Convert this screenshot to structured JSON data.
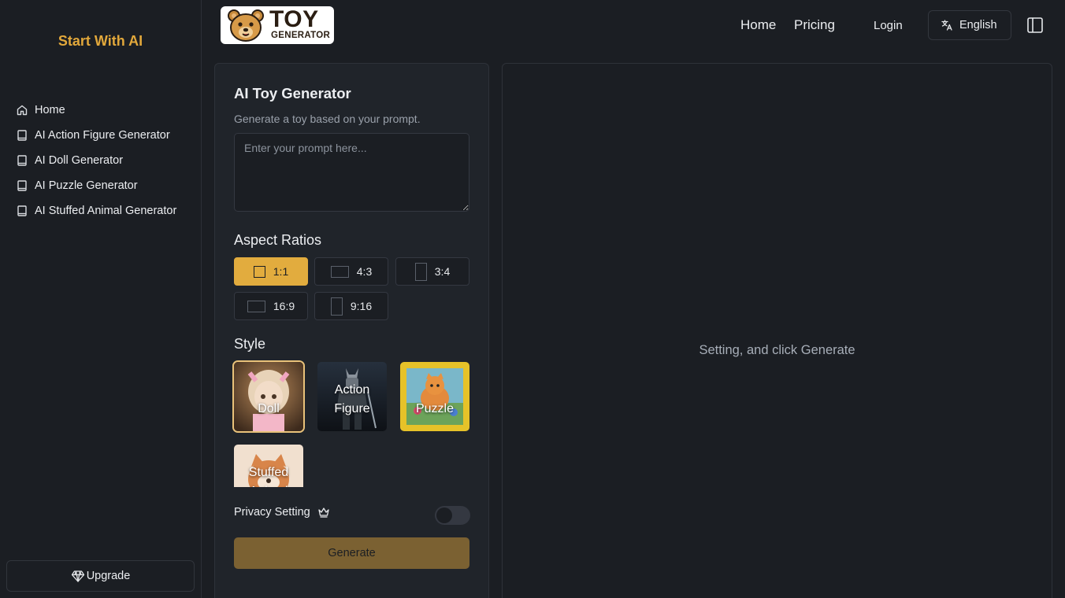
{
  "sidebar": {
    "brand": "Start With AI",
    "items": [
      {
        "label": "Home",
        "icon": "home-icon"
      },
      {
        "label": "AI Action Figure Generator",
        "icon": "book-icon"
      },
      {
        "label": "AI Doll Generator",
        "icon": "book-icon"
      },
      {
        "label": "AI Puzzle Generator",
        "icon": "book-icon"
      },
      {
        "label": "AI Stuffed Animal Generator",
        "icon": "book-icon"
      }
    ],
    "upgrade_label": "Upgrade"
  },
  "header": {
    "logo_line1": "TOY",
    "logo_line2": "GENERATOR",
    "nav": [
      "Home",
      "Pricing"
    ],
    "login": "Login",
    "language": "English"
  },
  "generator": {
    "title": "AI Toy Generator",
    "subtitle": "Generate a toy based on your prompt.",
    "prompt_placeholder": "Enter your prompt here...",
    "prompt_value": "",
    "aspect_title": "Aspect Ratios",
    "ratios": [
      {
        "label": "1:1",
        "selected": true
      },
      {
        "label": "4:3",
        "selected": false
      },
      {
        "label": "3:4",
        "selected": false
      },
      {
        "label": "16:9",
        "selected": false
      },
      {
        "label": "9:16",
        "selected": false
      }
    ],
    "style_title": "Style",
    "styles": [
      {
        "label": "Doll",
        "selected": true
      },
      {
        "label": "Action Figure",
        "selected": false
      },
      {
        "label": "Puzzle",
        "selected": false
      },
      {
        "label": "Stuffed Animal",
        "selected": false
      }
    ],
    "privacy_label": "Privacy Setting",
    "privacy_enabled": false,
    "generate_label": "Generate"
  },
  "preview": {
    "message": "Setting, and click Generate"
  },
  "colors": {
    "accent": "#e2ac3e",
    "background": "#1b1e23",
    "card": "#20242a"
  }
}
